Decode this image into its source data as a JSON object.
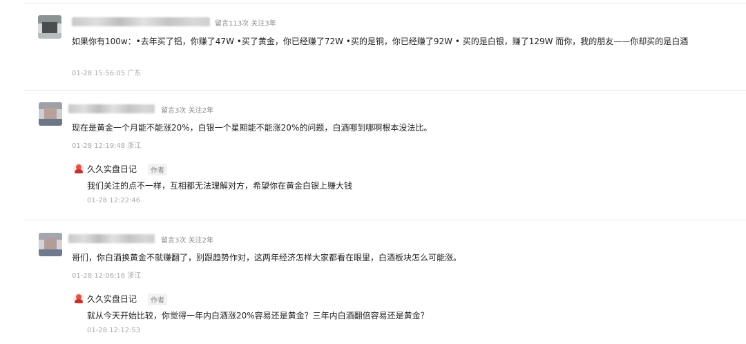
{
  "comments": [
    {
      "stats": "留言113次 关注3年",
      "text": "如果你有100w：•去年买了铝，你赚了47W  •买了黄金，你已经赚了72W  •买的是铜，你已经赚了92W  • 买的是白银，赚了129W  而你，我的朋友——你却买的是白酒",
      "time": "01-28 15:56:05 广东"
    },
    {
      "stats": "留言3次 关注2年",
      "text": "现在是黄金一个月能不能涨20%，白银一个星期能不能涨20%的问题，白酒哪到哪啊根本没法比。",
      "time": "01-28 12:19:48 浙江",
      "reply": {
        "author": "久久实盘日记",
        "badge": "作者",
        "text": "我们关注的点不一样，互相都无法理解对方，希望你在黄金白银上赚大钱",
        "time": "01-28 12:22:46"
      }
    },
    {
      "stats": "留言3次 关注2年",
      "text": "哥们，你白酒换黄金不就赚翻了，别跟趋势作对，这两年经济怎样大家都看在眼里，白酒板块怎么可能涨。",
      "time": "01-28 12:06:16 浙江",
      "reply": {
        "author": "久久实盘日记",
        "badge": "作者",
        "text": "就从今天开始比较，你觉得一年内白酒涨20%容易还是黄金？三年内白酒翻倍容易还是黄金？",
        "time": "01-28 12:12:53"
      }
    }
  ]
}
